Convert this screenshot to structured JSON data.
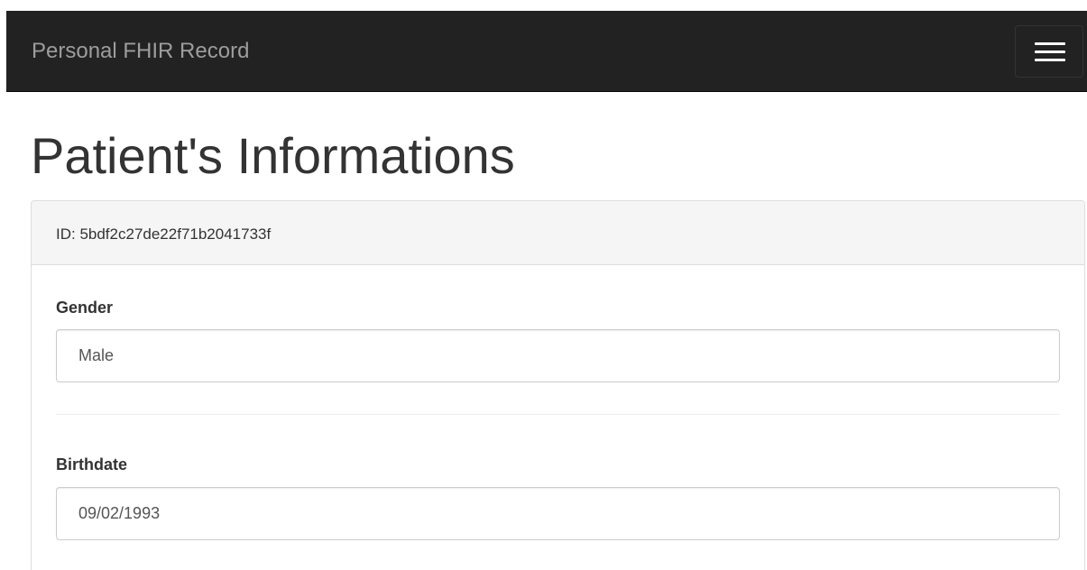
{
  "navbar": {
    "brand": "Personal FHIR Record",
    "menu_icon": "hamburger-menu-icon"
  },
  "page": {
    "title": "Patient's Informations"
  },
  "panel": {
    "heading": "ID: 5bdf2c27de22f71b2041733f",
    "fields": [
      {
        "label": "Gender",
        "value": "Male"
      },
      {
        "label": "Birthdate",
        "value": "09/02/1993"
      }
    ]
  },
  "colors": {
    "navbar_bg": "#222222",
    "brand_text": "#9d9d9d",
    "panel_heading_bg": "#f5f5f5",
    "border": "#dddddd"
  }
}
